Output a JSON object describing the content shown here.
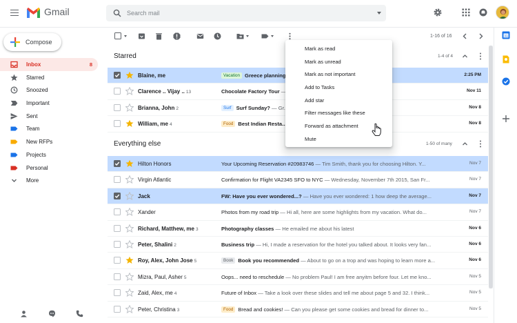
{
  "header": {
    "brand": "Gmail",
    "search_placeholder": "Search mail"
  },
  "compose": {
    "label": "Compose"
  },
  "sidebar": {
    "items": [
      {
        "label": "Inbox",
        "count": "8",
        "icon": "inbox-icon",
        "active": true
      },
      {
        "label": "Starred",
        "count": "",
        "icon": "star-icon"
      },
      {
        "label": "Snoozed",
        "count": "",
        "icon": "clock-icon"
      },
      {
        "label": "Important",
        "count": "",
        "icon": "important-icon"
      },
      {
        "label": "Sent",
        "count": "",
        "icon": "send-icon"
      },
      {
        "label": "Team",
        "count": "",
        "icon": "label-icon",
        "color": "#1a73e8"
      },
      {
        "label": "New RFPs",
        "count": "",
        "icon": "label-icon",
        "color": "#f9ab00"
      },
      {
        "label": "Projects",
        "count": "",
        "icon": "label-icon",
        "color": "#1a73e8"
      },
      {
        "label": "Personal",
        "count": "",
        "icon": "label-icon",
        "color": "#d93025"
      },
      {
        "label": "More",
        "count": "",
        "icon": "chevron-down-icon"
      }
    ]
  },
  "toolbar": {
    "pager": "1-16 of 16"
  },
  "starred_section": {
    "title": "Starred",
    "count": "1-4 of 4"
  },
  "everything_section": {
    "title": "Everything else",
    "count": "1-50 of many"
  },
  "starred_rows": [
    {
      "sender": "Blaine",
      "sender_rest": ", me",
      "count": "",
      "tag": "Vacation",
      "tag_bg": "#ddf5d8",
      "tag_fg": "#137333",
      "subject": "Greece planning",
      "snippet": " — ... in Santorini for the...",
      "date": "2:25 PM",
      "starred": true,
      "selected": true,
      "unread": true
    },
    {
      "sender": "Clarence",
      "sender_rest": " .. Vijay ..",
      "count": "13",
      "tag": "",
      "subject": "Chocolate Factory Tour",
      "snippet": " — ...icket! The tour begins...",
      "date": "Nov 11",
      "starred": false,
      "selected": false,
      "unread": true
    },
    {
      "sender": "Brianna",
      "sender_rest": ", John",
      "count": "2",
      "tag": "Surf",
      "tag_bg": "#e3f0ff",
      "tag_fg": "#1a73e8",
      "subject": "Surf Sunday?",
      "snippet": " — Gr...",
      "date": "Nov 8",
      "starred": false,
      "selected": false,
      "unread": true
    },
    {
      "sender": "William",
      "sender_rest": ", me",
      "count": "4",
      "tag": "Food",
      "tag_bg": "#fdecc8",
      "tag_fg": "#b06000",
      "subject": "Best Indian Resta...",
      "snippet": " — Indian places in the...",
      "date": "Nov 8",
      "starred": true,
      "selected": false,
      "unread": true
    }
  ],
  "everything_rows": [
    {
      "sender": "Hilton Honors",
      "sender_rest": "",
      "count": "",
      "tag": "",
      "subject": "Your Upcoming Reservation #20983746",
      "snippet": " — Tim Smith, thank you for choosing Hilton. Y...",
      "date": "Nov 7",
      "starred": true,
      "selected": true,
      "unread": false
    },
    {
      "sender": "Virgin Atlantic",
      "sender_rest": "",
      "count": "",
      "tag": "",
      "subject": "Confirmation for Flight VA2345 SFO to NYC",
      "snippet": " — Wednesday, November 7th 2015, San Fr...",
      "date": "Nov 7",
      "starred": false,
      "selected": false,
      "unread": false
    },
    {
      "sender": "Jack",
      "sender_rest": "",
      "count": "",
      "tag": "",
      "subject": "FW: Have you ever wondered...?",
      "snippet": " — Have you ever wondered: 1 how deep the average...",
      "date": "Nov 7",
      "starred": false,
      "selected": true,
      "unread": true
    },
    {
      "sender": "Xander",
      "sender_rest": "",
      "count": "",
      "tag": "",
      "subject": "Photos from my road trip",
      "snippet": " — Hi all, here are some highlights from my vacation. What do...",
      "date": "Nov 7",
      "starred": false,
      "selected": false,
      "unread": false
    },
    {
      "sender": "Richard",
      "sender_rest": ", Matthew, me",
      "count": "3",
      "tag": "",
      "subject": "Photography classes",
      "snippet": " — He emailed me about his latest",
      "date": "Nov 6",
      "starred": false,
      "selected": false,
      "unread": true
    },
    {
      "sender": "Peter, Shalini",
      "sender_rest": "",
      "count": "2",
      "tag": "",
      "subject": "Business trip",
      "snippet": " — Hi, I made a reservation for the hotel you talked about. It looks very fan...",
      "date": "Nov 6",
      "starred": false,
      "selected": false,
      "unread": true
    },
    {
      "sender": "Roy",
      "sender_rest": ", Alex, John Jose",
      "count": "5",
      "tag": "Book",
      "tag_bg": "#e8eaed",
      "tag_fg": "#5f6368",
      "subject": "Book you recommended",
      "snippet": " — About to go on a trop and was hoping to learn more a...",
      "date": "Nov 6",
      "starred": true,
      "selected": false,
      "unread": true
    },
    {
      "sender": "Mizra, Paul, Asher",
      "sender_rest": "",
      "count": "5",
      "tag": "",
      "subject": "Oops... need to reschedule",
      "snippet": " — No problem Paul! I am free anyitm before four. Let me kno...",
      "date": "Nov 5",
      "starred": false,
      "selected": false,
      "unread": false
    },
    {
      "sender": "Zaid, Alex, me",
      "sender_rest": "",
      "count": "4",
      "tag": "",
      "subject": "Future of Inbox",
      "snippet": " — Take a look over these slides and tell me about page 5 and 32. I think...",
      "date": "Nov 5",
      "starred": false,
      "selected": false,
      "unread": false
    },
    {
      "sender": "Peter, Christina",
      "sender_rest": "",
      "count": "3",
      "tag": "Food",
      "tag_bg": "#fdecc8",
      "tag_fg": "#b06000",
      "subject": "Bread and cookies!",
      "snippet": " — Can you please get some cookies and bread for dinner to...",
      "date": "Nov 5",
      "starred": false,
      "selected": false,
      "unread": false
    }
  ],
  "context_menu": {
    "items": [
      "Mark as read",
      "Mark as unread",
      "Mark as not important",
      "Add to Tasks",
      "Add star",
      "Filter messages like these",
      "Forward as attachment",
      "Mute"
    ]
  }
}
